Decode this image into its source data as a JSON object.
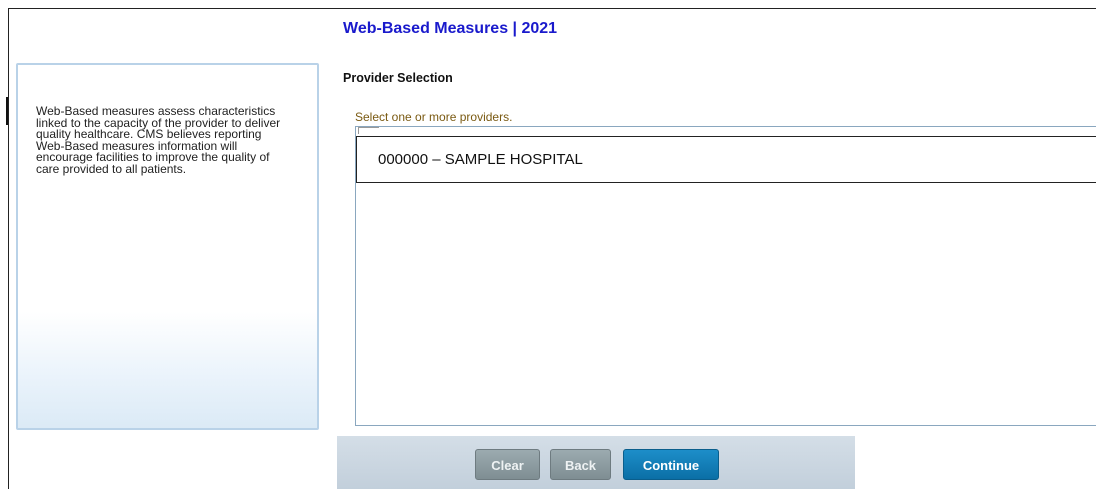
{
  "header": {
    "title": "Web-Based Measures | 2021"
  },
  "info_panel": {
    "description": "Web-Based measures assess characteristics linked to the capacity of the provider to deliver quality healthcare. CMS believes reporting Web-Based measures information will encourage facilities to improve the quality of care provided to all patients."
  },
  "provider_selection": {
    "section_title": "Provider Selection",
    "instruction": "Select one or more providers.",
    "providers": [
      {
        "label": "000000 – SAMPLE HOSPITAL"
      }
    ]
  },
  "buttons": {
    "clear_label": "Clear",
    "back_label": "Back",
    "continue_label": "Continue"
  },
  "colors": {
    "title": "#1a1acc",
    "instruction": "#7a5a12",
    "primary_button": "#0b6fa6",
    "secondary_button": "#7f8e93"
  }
}
